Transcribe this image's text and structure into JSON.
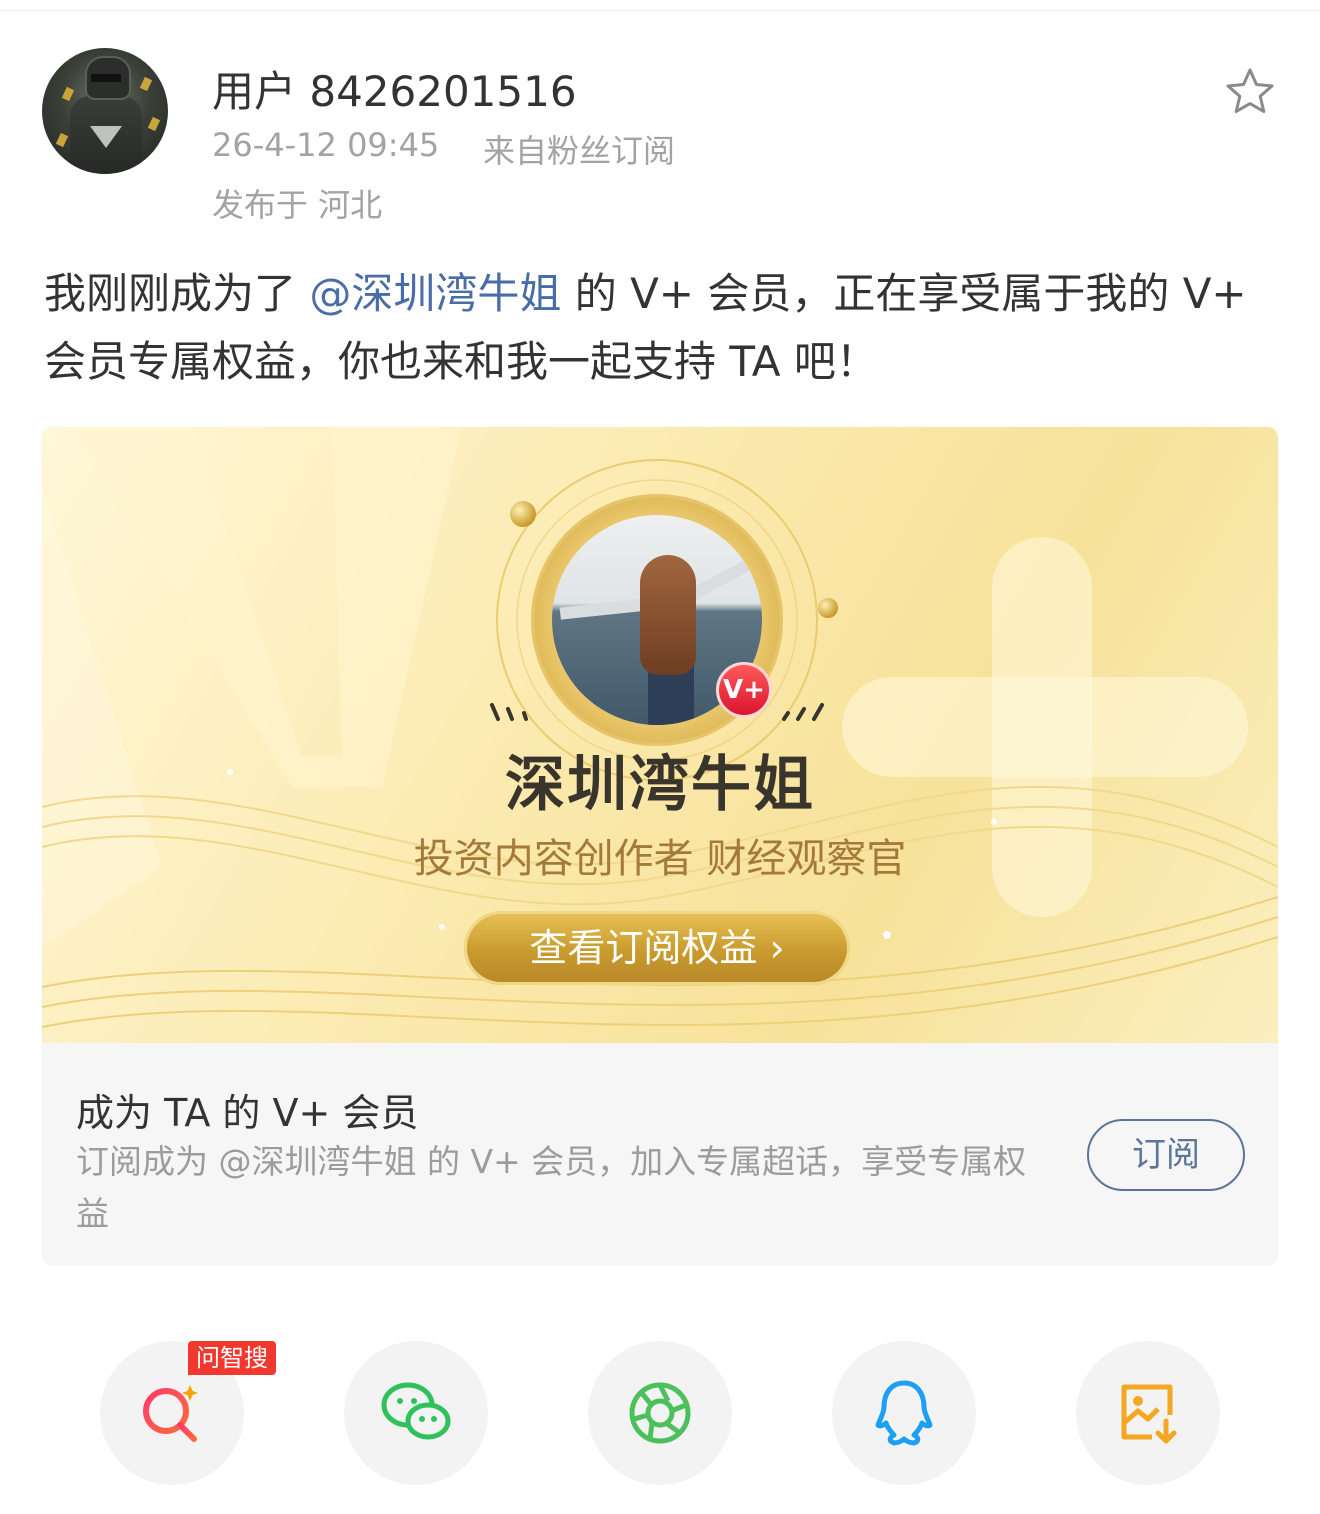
{
  "post": {
    "username": "用户 8426201516",
    "time": "26-4-12 09:45",
    "source": "来自粉丝订阅",
    "location": "发布于 河北",
    "text_before": "我刚刚成为了 ",
    "mention": "@深圳湾牛姐",
    "text_after": " 的 V+ 会员，正在享受属于我的 V+ 会员专属权益，你也来和我一起支持 TA 吧！"
  },
  "banner": {
    "creator_name": "深圳湾牛姐",
    "creator_desc": "投资内容创作者 财经观察官",
    "vplus_badge": "V+",
    "view_button": "查看订阅权益 ›"
  },
  "card": {
    "title": "成为 TA 的 V+ 会员",
    "description": "订阅成为 @深圳湾牛姐 的 V+ 会员，加入专属超话，享受专属权益",
    "subscribe_button": "订阅"
  },
  "share": {
    "wzs_tag": "问智搜",
    "items": [
      "search-ai-icon",
      "wechat-icon",
      "moments-icon",
      "qq-icon",
      "save-image-icon"
    ]
  },
  "colors": {
    "mention": "#4a6da8",
    "gold": "#c99a2d",
    "red_tag": "#f0382f",
    "wechat_green": "#2ec15c",
    "qq_blue": "#1ea0f2",
    "save_orange": "#f5a623"
  }
}
